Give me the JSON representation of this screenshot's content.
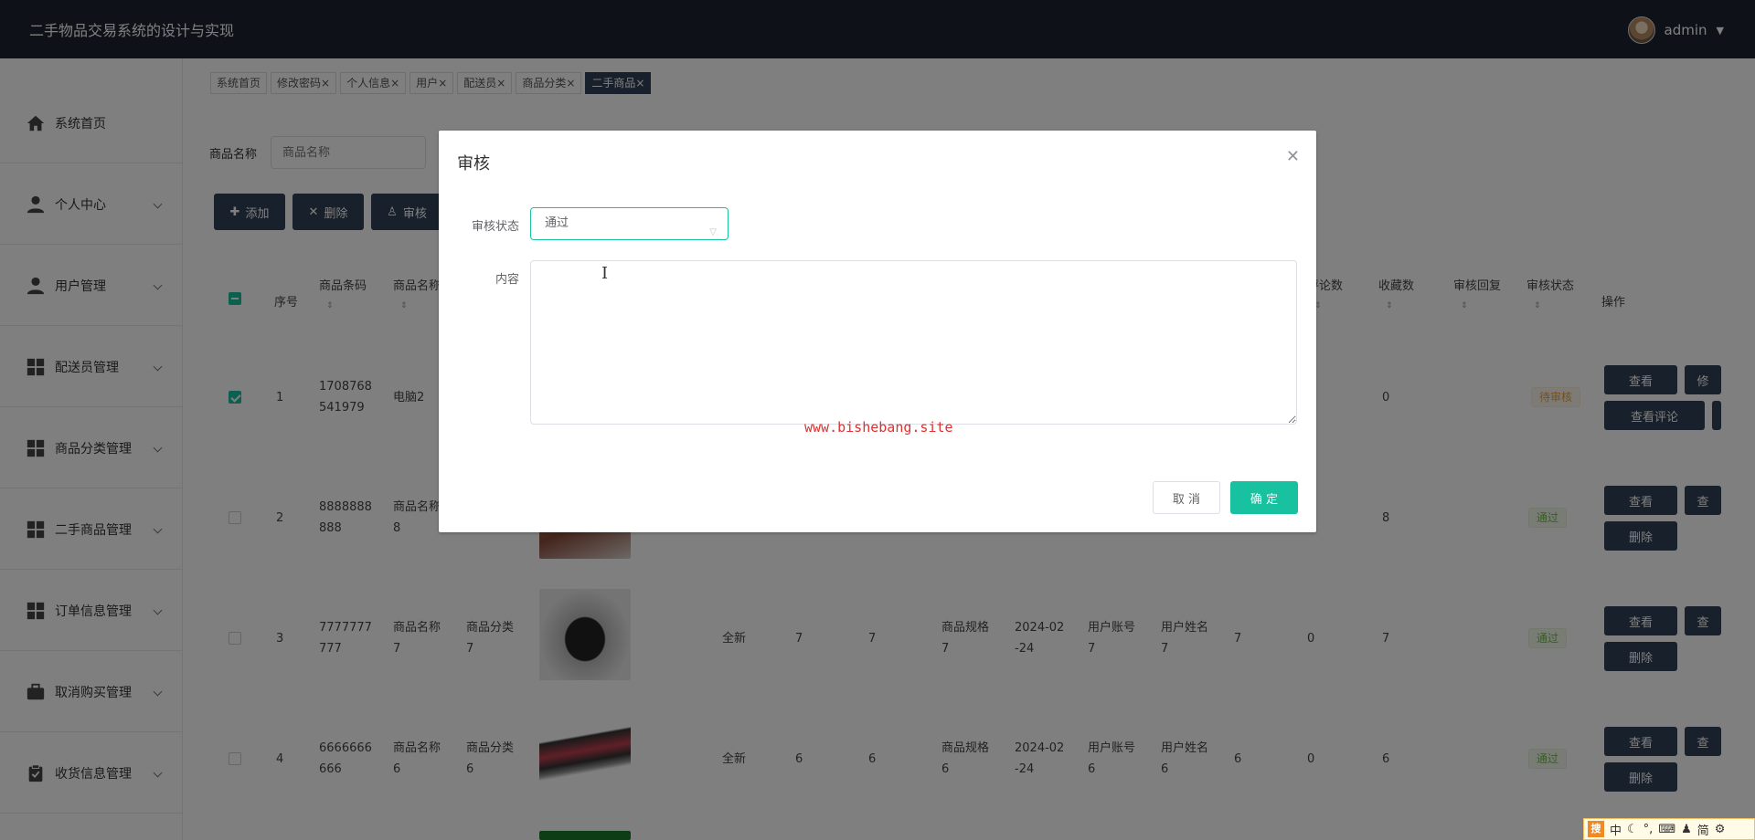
{
  "header": {
    "title": "二手物品交易系统的设计与实现",
    "username": "admin"
  },
  "sidebar": {
    "items": [
      {
        "label": "系统首页",
        "icon": "home-icon"
      },
      {
        "label": "个人中心",
        "icon": "user-icon"
      },
      {
        "label": "用户管理",
        "icon": "user-icon"
      },
      {
        "label": "配送员管理",
        "icon": "grid-icon"
      },
      {
        "label": "商品分类管理",
        "icon": "grid-icon"
      },
      {
        "label": "二手商品管理",
        "icon": "grid-icon"
      },
      {
        "label": "订单信息管理",
        "icon": "grid-icon"
      },
      {
        "label": "取消购买管理",
        "icon": "briefcase-icon"
      },
      {
        "label": "收货信息管理",
        "icon": "clipboard-icon"
      }
    ]
  },
  "tabs": [
    {
      "label": "系统首页",
      "closable": false
    },
    {
      "label": "修改密码",
      "closable": true
    },
    {
      "label": "个人信息",
      "closable": true
    },
    {
      "label": "用户",
      "closable": true
    },
    {
      "label": "配送员",
      "closable": true
    },
    {
      "label": "商品分类",
      "closable": true
    },
    {
      "label": "二手商品",
      "closable": true,
      "active": true
    }
  ],
  "filter": {
    "label": "商品名称",
    "placeholder": "商品名称"
  },
  "toolbar": {
    "add": "添加",
    "delete": "删除",
    "audit": "审核"
  },
  "table": {
    "headers": {
      "index": "序号",
      "code": "商品条码",
      "name": "商品名称",
      "comments": "评论数",
      "favorites": "收藏数",
      "reply": "审核回复",
      "status": "审核状态",
      "ops": "操作"
    },
    "rows": [
      {
        "index": "1",
        "code": "1708768\n541979",
        "name": "电脑2",
        "favorites": "0",
        "status": "待审核",
        "status_type": "pending",
        "checked": true
      },
      {
        "index": "2",
        "code": "8888888\n888",
        "name": "商品名称\n8",
        "favorites": "8",
        "status": "通过",
        "status_type": "pass",
        "checked": false
      },
      {
        "index": "3",
        "code": "7777777\n777",
        "name": "商品名称\n7",
        "category": "商品分类\n7",
        "condition": "全新",
        "col_a": "7",
        "col_b": "7",
        "spec": "商品规格\n7",
        "date": "2024-02\n-24",
        "account": "用户账号\n7",
        "uname": "用户姓名\n7",
        "clicks": "7",
        "comments": "0",
        "favorites": "7",
        "status": "通过",
        "status_type": "pass",
        "checked": false
      },
      {
        "index": "4",
        "code": "6666666\n666",
        "name": "商品名称\n6",
        "category": "商品分类\n6",
        "condition": "全新",
        "col_a": "6",
        "col_b": "6",
        "spec": "商品规格\n6",
        "date": "2024-02\n-24",
        "account": "用户账号\n6",
        "uname": "用户姓名\n6",
        "clicks": "6",
        "comments": "0",
        "favorites": "6",
        "status": "通过",
        "status_type": "pass",
        "checked": false
      }
    ],
    "btn_view": "查看",
    "btn_view_comments": "查看评论",
    "btn_delete": "删除"
  },
  "dialog": {
    "title": "审核",
    "status_label": "审核状态",
    "status_value": "通过",
    "content_label": "内容",
    "watermark": "www.bishebang.site",
    "cancel": "取 消",
    "confirm": "确 定"
  },
  "ime": {
    "logo": "搜",
    "lang": "中",
    "mode": "简"
  },
  "colors": {
    "header_bg": "#1c2430",
    "accent": "#18c1a0",
    "button_dark": "#304156"
  }
}
